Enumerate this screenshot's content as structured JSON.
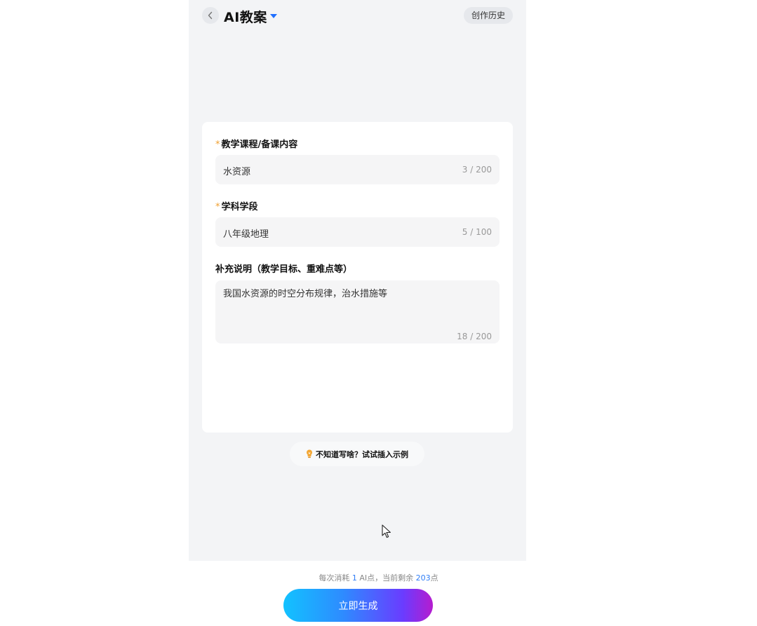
{
  "header": {
    "title": "AI教案",
    "history_label": "创作历史"
  },
  "form": {
    "course": {
      "required_mark": "*",
      "label": "教学课程/备课内容",
      "value": "水资源",
      "counter": "3 / 200"
    },
    "subject": {
      "required_mark": "*",
      "label": "学科学段",
      "value": "八年级地理",
      "counter": "5 / 100"
    },
    "notes": {
      "label": "补充说明（教学目标、重难点等）",
      "value": "我国水资源的时空分布规律，治水措施等",
      "counter": "18 / 200"
    }
  },
  "tip": {
    "icon": "lightbulb-icon",
    "label": "不知道写啥？试试插入示例"
  },
  "footer": {
    "cost_prefix": "每次消耗 ",
    "cost_amount": "1",
    "cost_mid": " AI点，当前剩余 ",
    "cost_remaining": "203",
    "cost_suffix": "点",
    "generate_label": "立即生成"
  },
  "colors": {
    "accent": "#1f6fff",
    "required": "#f0a030",
    "highlight": "#2f7df6"
  }
}
